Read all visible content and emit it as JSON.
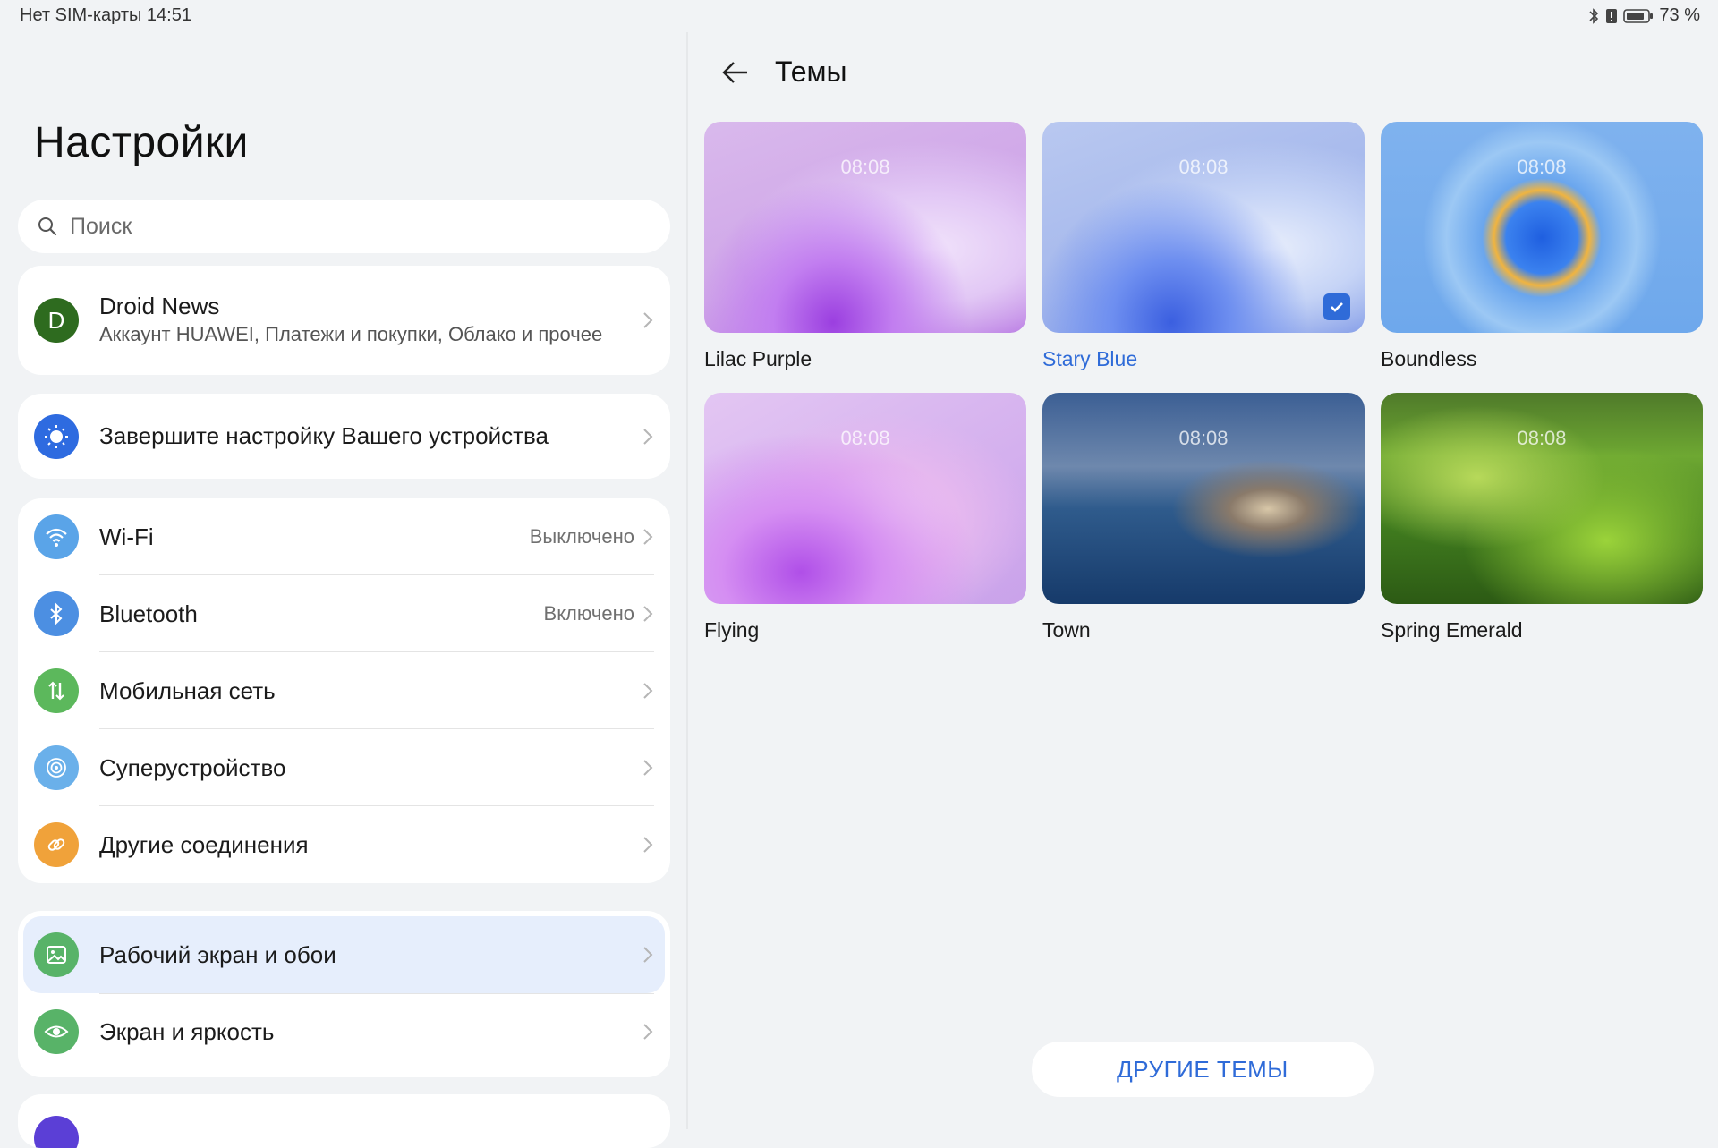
{
  "status_bar": {
    "left_text": "Нет SIM-карты 14:51",
    "battery": "73 %"
  },
  "settings": {
    "title": "Настройки",
    "search": {
      "placeholder": "Поиск"
    },
    "account": {
      "avatar_letter": "D",
      "name": "Droid News",
      "subtitle": "Аккаунт HUAWEI, Платежи и покупки, Облако и прочее"
    },
    "setup": {
      "label": "Завершите настройку Вашего устройства"
    },
    "connectivity": [
      {
        "label": "Wi-Fi",
        "value": "Выключено",
        "icon": "wifi-icon",
        "color": "#5aa4e8"
      },
      {
        "label": "Bluetooth",
        "value": "Включено",
        "icon": "bluetooth-icon",
        "color": "#4c8fe2"
      },
      {
        "label": "Мобильная сеть",
        "value": "",
        "icon": "mobile-data-icon",
        "color": "#5cb85c"
      },
      {
        "label": "Суперустройство",
        "value": "",
        "icon": "super-device-icon",
        "color": "#6ab0ea"
      },
      {
        "label": "Другие соединения",
        "value": "",
        "icon": "link-icon",
        "color": "#f0a23a"
      }
    ],
    "display": [
      {
        "label": "Рабочий экран и обои",
        "icon": "wallpaper-icon",
        "color": "#58b368",
        "selected": true
      },
      {
        "label": "Экран и яркость",
        "icon": "eye-icon",
        "color": "#58b368",
        "selected": false
      }
    ]
  },
  "themes": {
    "title": "Темы",
    "clock": "08:08",
    "items": [
      {
        "name": "Lilac Purple",
        "selected": false
      },
      {
        "name": "Stary Blue",
        "selected": true
      },
      {
        "name": "Boundless",
        "selected": false
      },
      {
        "name": "Flying",
        "selected": false
      },
      {
        "name": "Town",
        "selected": false
      },
      {
        "name": "Spring Emerald",
        "selected": false
      }
    ],
    "more_button": "ДРУГИЕ ТЕМЫ"
  },
  "colors": {
    "accent": "#2f6bd8",
    "background": "#f1f3f5",
    "selected_row": "#e6eefc"
  }
}
